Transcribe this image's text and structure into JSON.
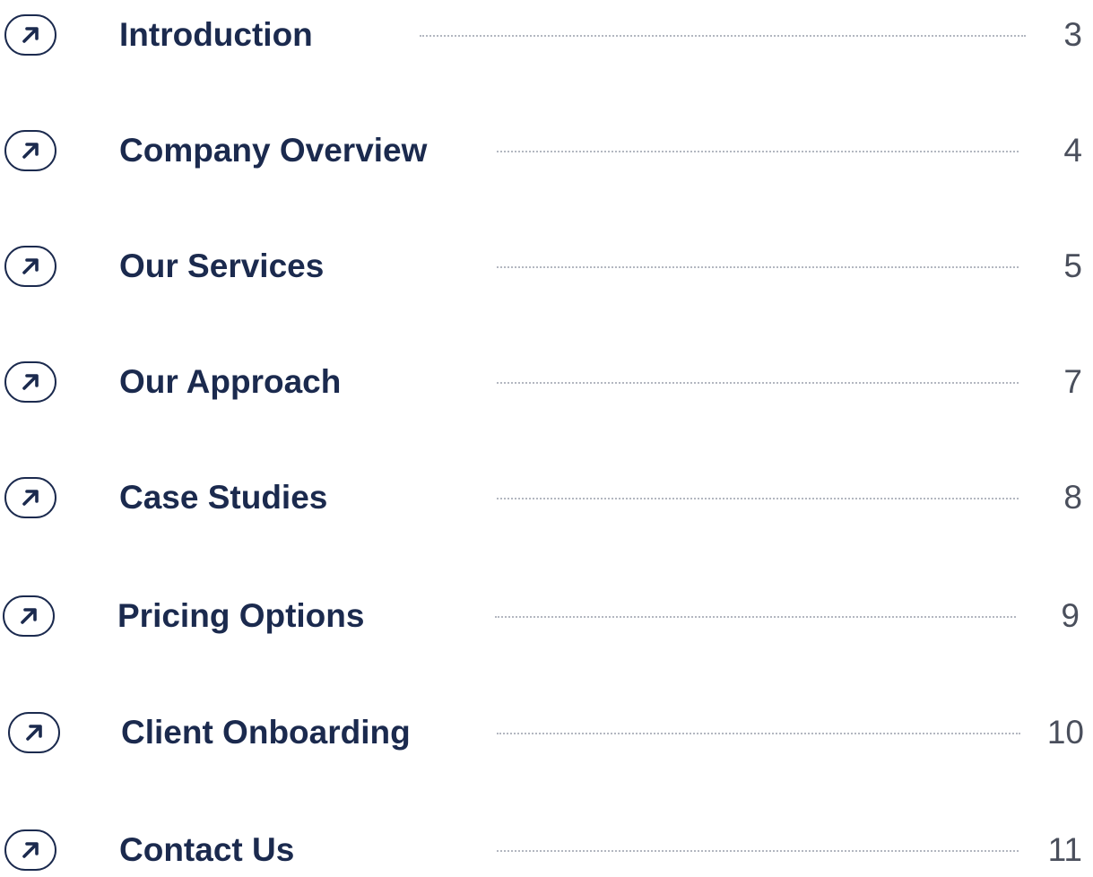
{
  "toc": {
    "items": [
      {
        "title": "Introduction",
        "page": "3",
        "icon": "arrow-up-right-icon"
      },
      {
        "title": "Company Overview",
        "page": "4",
        "icon": "arrow-up-right-icon"
      },
      {
        "title": "Our Services",
        "page": "5",
        "icon": "arrow-up-right-icon"
      },
      {
        "title": "Our Approach",
        "page": "7",
        "icon": "arrow-up-right-icon"
      },
      {
        "title": "Case Studies",
        "page": "8",
        "icon": "arrow-up-right-icon"
      },
      {
        "title": "Pricing Options",
        "page": "9",
        "icon": "arrow-up-right-icon"
      },
      {
        "title": "Client Onboarding",
        "page": "10",
        "icon": "arrow-up-right-icon"
      },
      {
        "title": "Contact Us",
        "page": "11",
        "icon": "arrow-up-right-icon"
      }
    ]
  },
  "colors": {
    "title": "#1b2a4e",
    "page_number": "#4a4f5c",
    "leader_dots": "#b3b7c0",
    "background": "#ffffff"
  }
}
